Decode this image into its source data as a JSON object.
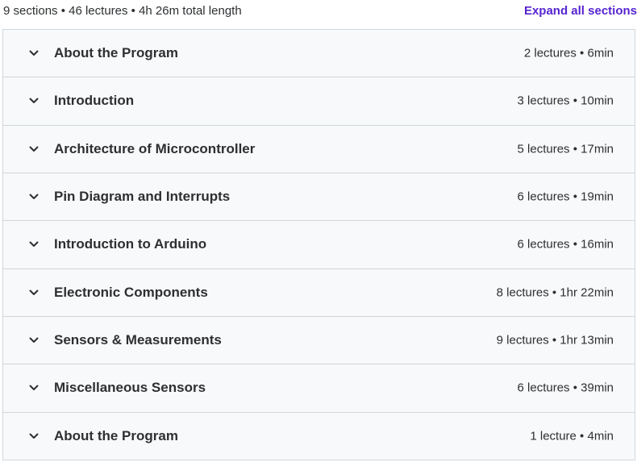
{
  "summary": {
    "text": "9 sections • 46 lectures • 4h 26m total length",
    "expand_label": "Expand all sections"
  },
  "sections": [
    {
      "title": "About the Program",
      "meta": "2 lectures • 6min"
    },
    {
      "title": "Introduction",
      "meta": "3 lectures • 10min"
    },
    {
      "title": "Architecture of Microcontroller",
      "meta": "5 lectures • 17min"
    },
    {
      "title": "Pin Diagram and Interrupts",
      "meta": "6 lectures • 19min"
    },
    {
      "title": "Introduction to Arduino",
      "meta": "6 lectures • 16min"
    },
    {
      "title": "Electronic Components",
      "meta": "8 lectures • 1hr 22min"
    },
    {
      "title": "Sensors & Measurements",
      "meta": "9 lectures • 1hr 13min"
    },
    {
      "title": "Miscellaneous Sensors",
      "meta": "6 lectures • 39min"
    },
    {
      "title": "About the Program",
      "meta": "1 lecture • 4min"
    }
  ],
  "icons": {
    "section_toggle": "chevron-down-icon"
  },
  "colors": {
    "accent": "#5624d0",
    "text": "#2d2f31",
    "panel_background": "#f7f9fa",
    "border": "#d1d7dc"
  }
}
